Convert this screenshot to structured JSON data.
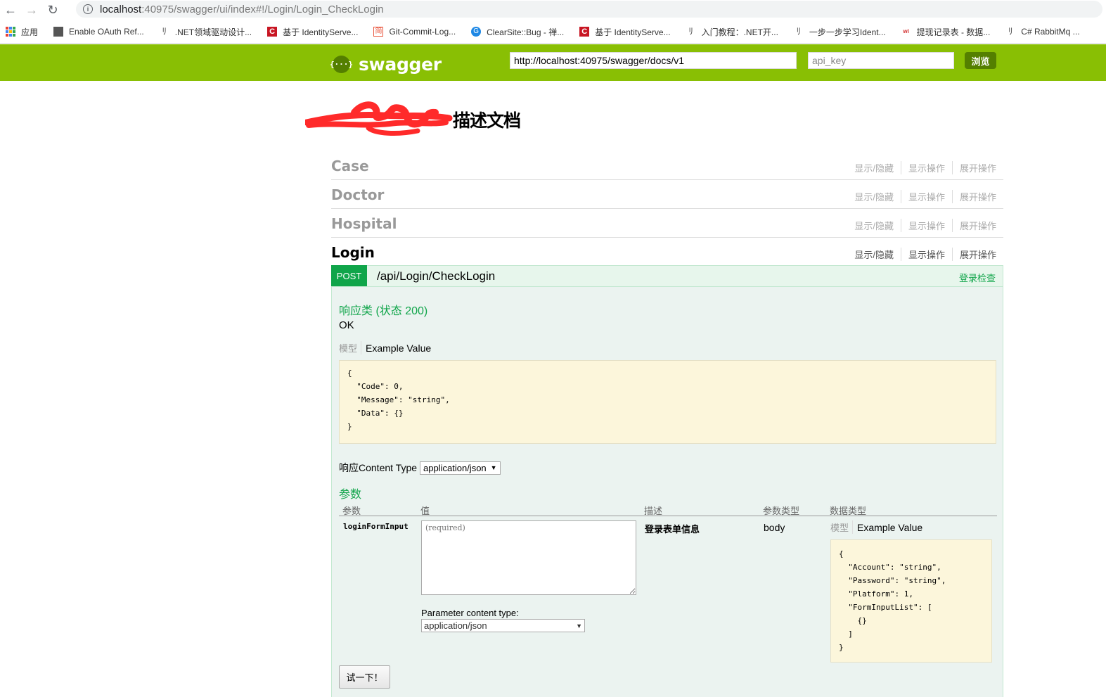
{
  "browser": {
    "url_host": "localhost",
    "url_rest": ":40975/swagger/ui/index#!/Login/Login_CheckLogin",
    "bookmarks": [
      {
        "label": "应用",
        "icon": "apps-icon"
      },
      {
        "label": "Enable OAuth Ref...",
        "icon": "site-icon"
      },
      {
        "label": ".NET领域驱动设计...",
        "icon": "cnblogs-icon"
      },
      {
        "label": "基于 IdentityServe...",
        "icon": "csdn-icon"
      },
      {
        "label": "Git-Commit-Log...",
        "icon": "jianshu-icon"
      },
      {
        "label": "ClearSite::Bug - 禅...",
        "icon": "zentao-icon"
      },
      {
        "label": "基于 IdentityServe...",
        "icon": "csdn-icon"
      },
      {
        "label": "入门教程：.NET开...",
        "icon": "cnblogs-icon"
      },
      {
        "label": "一步一步学习Ident...",
        "icon": "cnblogs-icon"
      },
      {
        "label": "提现记录表 - 数据...",
        "icon": "wiki-icon"
      },
      {
        "label": "C# RabbitMq ...",
        "icon": "cnblogs-icon"
      }
    ]
  },
  "swagger": {
    "logo_text": "swagger",
    "logo_glyph": "{···}",
    "base_url": "http://localhost:40975/swagger/docs/v1",
    "api_key_placeholder": "api_key",
    "explore_label": "浏览",
    "brand_color": "#89bf04"
  },
  "page_title": "描述文档",
  "resource_ops": [
    "显示/隐藏",
    "显示操作",
    "展开操作"
  ],
  "resources": [
    {
      "name": "Case"
    },
    {
      "name": "Doctor"
    },
    {
      "name": "Hospital"
    },
    {
      "name": "Login"
    }
  ],
  "operation": {
    "method": "POST",
    "path": "/api/Login/CheckLogin",
    "summary": "登录检查",
    "response_class_title": "响应类 (状态 200)",
    "response_status_text": "OK",
    "model_tab": "模型",
    "example_tab": "Example Value",
    "response_example": "{\n  \"Code\": 0,\n  \"Message\": \"string\",\n  \"Data\": {}\n}",
    "response_content_type_label": "响应Content Type",
    "response_content_type": "application/json",
    "params_title": "参数",
    "params_headers": [
      "参数",
      "值",
      "描述",
      "参数类型",
      "数据类型"
    ],
    "param": {
      "name": "loginFormInput",
      "placeholder": "(required)",
      "content_type_label": "Parameter content type:",
      "content_type": "application/json",
      "description": "登录表单信息",
      "param_type": "body",
      "example": "{\n  \"Account\": \"string\",\n  \"Password\": \"string\",\n  \"Platform\": 1,\n  \"FormInputList\": [\n    {}\n  ]\n}"
    },
    "try_button": "试一下！"
  }
}
